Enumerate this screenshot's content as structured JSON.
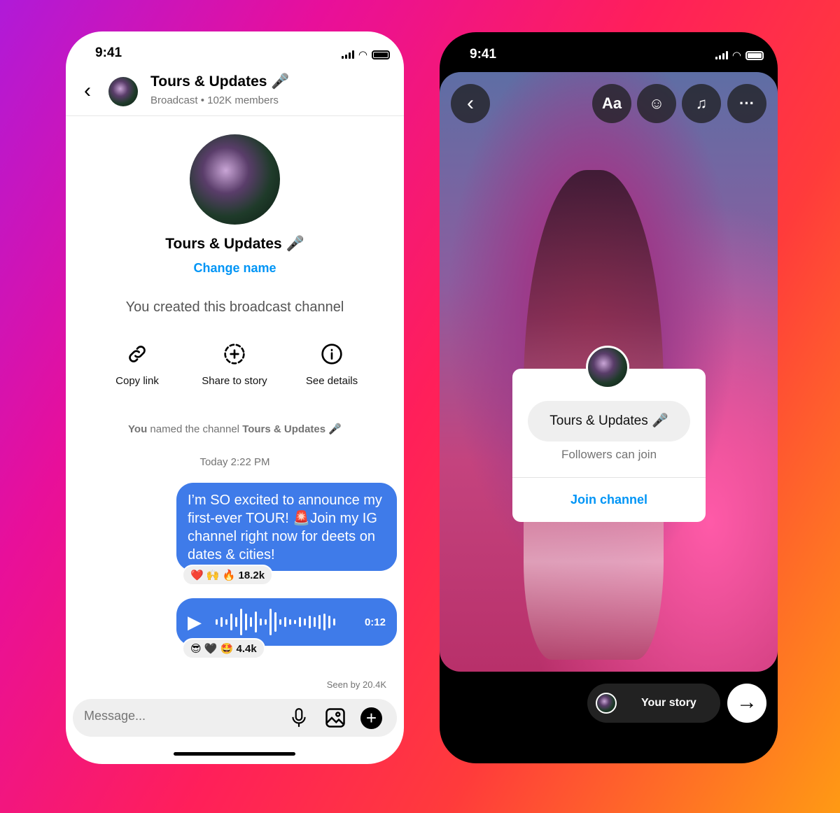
{
  "left_phone": {
    "status_time": "9:41",
    "header": {
      "title": "Tours & Updates",
      "subtitle": "Broadcast • 102K members"
    },
    "profile": {
      "name": "Tours & Updates",
      "change_name": "Change name"
    },
    "created_text": "You created this broadcast channel",
    "actions": [
      {
        "label": "Copy link",
        "icon": "link-icon"
      },
      {
        "label": "Share to story",
        "icon": "add-story-icon"
      },
      {
        "label": "See details",
        "icon": "info-icon"
      }
    ],
    "named_prefix": "You",
    "named_middle": " named the channel ",
    "named_name": "Tours & Updates",
    "timestamp": "Today 2:22 PM",
    "message": {
      "text": "I’m SO excited to announce my first-ever TOUR! 🚨Join my IG channel right now for deets on dates & cities!",
      "reactions": "❤️ 🙌 🔥",
      "count": "18.2k"
    },
    "voice": {
      "duration": "0:12",
      "reactions": "😎 🖤 🤩",
      "count": "4.4k"
    },
    "seen": "Seen by 20.4K",
    "composer": {
      "placeholder": "Message..."
    }
  },
  "right_phone": {
    "status_time": "9:41",
    "tools": {
      "text": "Aa"
    },
    "card": {
      "channel": "Tours & Updates",
      "subtitle": "Followers can join",
      "join": "Join channel"
    },
    "your_story": "Your story"
  },
  "colors": {
    "accent": "#0095f6",
    "bubble": "#3f7be9"
  }
}
